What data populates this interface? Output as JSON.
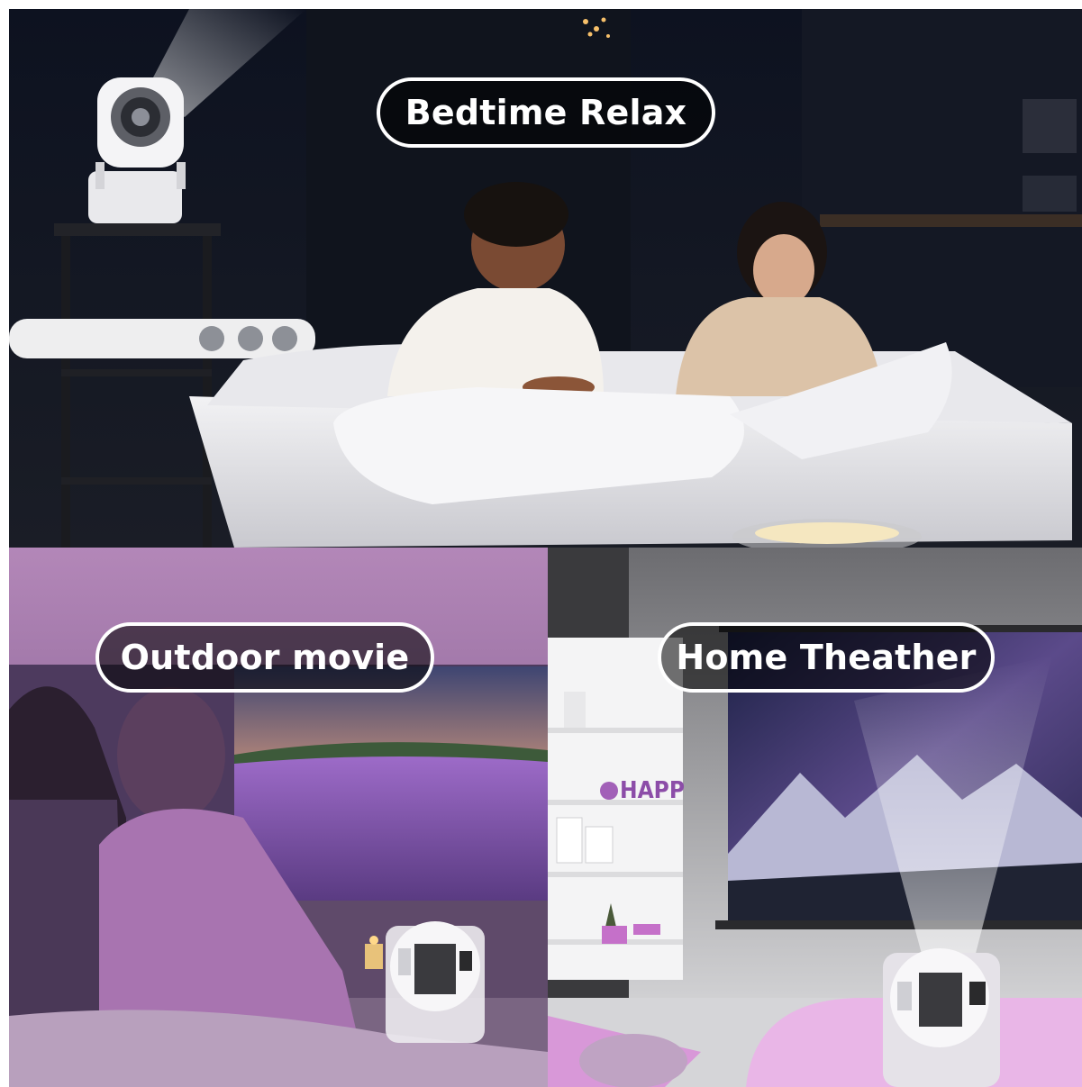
{
  "scenes": {
    "bedtime": {
      "label": "Bedtime Relax"
    },
    "outdoor": {
      "label": "Outdoor movie"
    },
    "home": {
      "label": "Home Theather"
    }
  },
  "shelf_sign": "HAPP",
  "colors": {
    "night": "#0b0e16",
    "lavender": "#8b5aa8",
    "pink": "#e6b3e6",
    "screen_sky": "#4a3f78",
    "label_border": "#ffffff"
  },
  "icons": [
    "projector-icon"
  ]
}
